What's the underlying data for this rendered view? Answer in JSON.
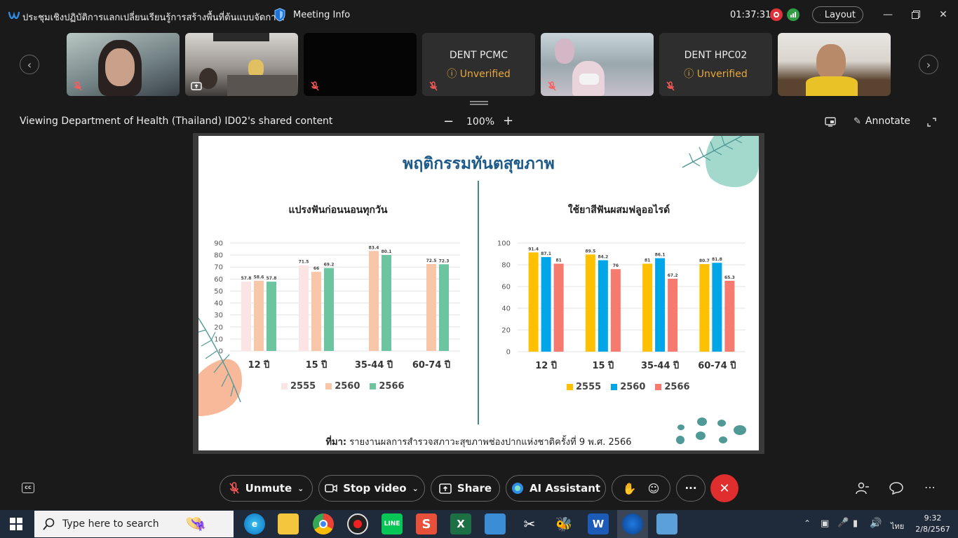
{
  "window": {
    "title": "ประชุมเชิงปฏิบัติการแลกเปลี่ยนเรียนรู้การสร้างพื้นที่ต้นแบบจัดกา...",
    "meeting_info_label": "Meeting Info",
    "timer": "01:37:31",
    "layout_label": "Layout"
  },
  "participants": [
    {
      "name": "",
      "type": "video"
    },
    {
      "name": "",
      "type": "video"
    },
    {
      "name": "",
      "type": "video-off"
    },
    {
      "name": "DENT PCMC",
      "status": "Unverified"
    },
    {
      "name": "",
      "type": "video"
    },
    {
      "name": "DENT HPC02",
      "status": "Unverified"
    },
    {
      "name": "",
      "type": "video"
    }
  ],
  "share_bar": {
    "viewing_text": "Viewing Department of Health (Thailand) ID02's shared content",
    "zoom": "100%",
    "annotate_label": "Annotate"
  },
  "slide": {
    "title": "พฤติกรรมทันตสุขภาพ",
    "source_bold": "ที่มา:",
    "source_text": " รายงานผลการสำรวจสภาวะสุขภาพช่องปากแห่งชาติครั้งที่ 9 พ.ศ. 2566"
  },
  "chart_data": [
    {
      "type": "bar",
      "title": "แปรงฟันก่อนนอนทุกวัน",
      "categories": [
        "12 ปี",
        "15 ปี",
        "35-44 ปี",
        "60-74 ปี"
      ],
      "series": [
        {
          "name": "2555",
          "color": "#fde4e4",
          "values": [
            57.8,
            71.5,
            null,
            null
          ]
        },
        {
          "name": "2560",
          "color": "#f8c6a8",
          "values": [
            58.6,
            66,
            83.4,
            72.5
          ]
        },
        {
          "name": "2566",
          "color": "#6cc4a0",
          "values": [
            57.8,
            69.2,
            80.1,
            72.3
          ]
        }
      ],
      "ylim": [
        0,
        90
      ],
      "yticks": [
        0,
        10,
        20,
        30,
        40,
        50,
        60,
        70,
        80,
        90
      ]
    },
    {
      "type": "bar",
      "title": "ใช้ยาสีฟันผสมฟลูออไรด์",
      "categories": [
        "12 ปี",
        "15 ปี",
        "35-44 ปี",
        "60-74 ปี"
      ],
      "series": [
        {
          "name": "2555",
          "color": "#ffc000",
          "values": [
            91.4,
            89.5,
            81,
            80.7
          ]
        },
        {
          "name": "2560",
          "color": "#00a6e8",
          "values": [
            87.1,
            84.2,
            86.1,
            81.8
          ]
        },
        {
          "name": "2566",
          "color": "#f77a6e",
          "values": [
            81,
            76,
            67.2,
            65.3
          ]
        }
      ],
      "ylim": [
        0,
        100
      ],
      "yticks": [
        0,
        20,
        40,
        60,
        80,
        100
      ]
    }
  ],
  "controls": {
    "unmute": "Unmute",
    "stop_video": "Stop video",
    "share": "Share",
    "ai_assistant": "AI Assistant",
    "more": "···"
  },
  "taskbar": {
    "search_placeholder": "Type here to search",
    "lang": "ไทย",
    "time": "9:32",
    "date": "2/8/2567"
  },
  "colors": {
    "leave": "#e02d2d",
    "unverified": "#e8a93a",
    "slide_title": "#1f5b8a",
    "divider": "#3d8a86"
  }
}
